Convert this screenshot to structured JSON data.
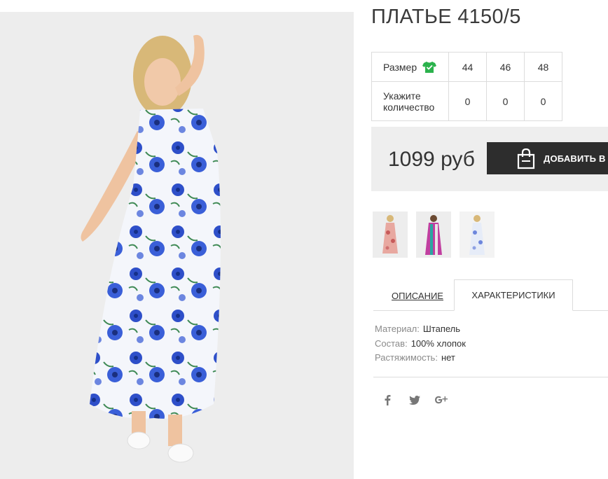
{
  "product": {
    "title": "ПЛАТЬЕ 4150/5"
  },
  "sizes": {
    "size_label": "Размер",
    "qty_label_line1": "Укажите",
    "qty_label_line2": "количество",
    "items": [
      {
        "size": "44",
        "qty": "0"
      },
      {
        "size": "46",
        "qty": "0"
      },
      {
        "size": "48",
        "qty": "0"
      }
    ]
  },
  "price": {
    "value": "1099 руб",
    "add_to_cart": "ДОБАВИТЬ В ЗАКАЗ"
  },
  "tabs": {
    "description": "ОПИСАНИЕ",
    "characteristics": "ХАРАКТЕРИСТИКИ"
  },
  "specs": [
    {
      "key": "Материал:",
      "value": "Штапель"
    },
    {
      "key": "Состав:",
      "value": "100% хлопок"
    },
    {
      "key": "Растяжимость:",
      "value": "нет"
    }
  ],
  "colors": {
    "button_bg": "#2d2d2d",
    "price_box_bg": "#eeeeee",
    "shirt_icon": "#2bb24c",
    "dress_blue": "#2e4fc9"
  },
  "icons": [
    "shirt-icon",
    "shopping-bag-icon",
    "facebook-icon",
    "twitter-icon",
    "google-plus-icon"
  ]
}
